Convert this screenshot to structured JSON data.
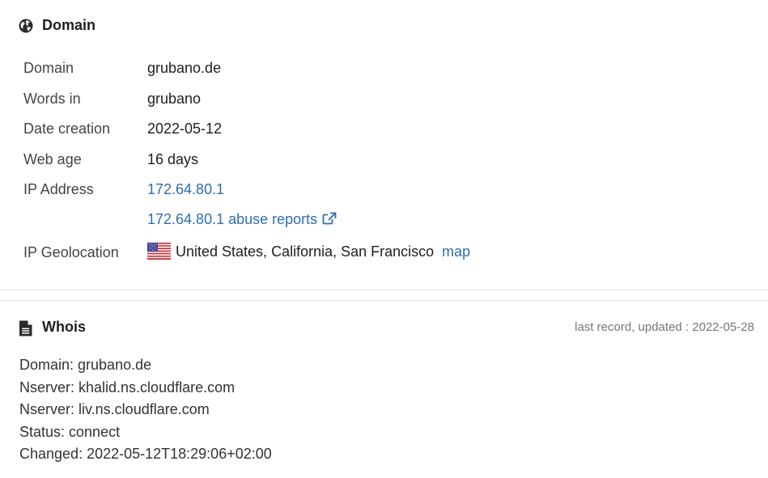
{
  "domain_section": {
    "title": "Domain",
    "icon": "globe-icon",
    "rows": {
      "domain": {
        "label": "Domain",
        "value": "grubano.de"
      },
      "words": {
        "label": "Words in",
        "value": "grubano"
      },
      "created": {
        "label": "Date creation",
        "value": "2022-05-12"
      },
      "age": {
        "label": "Web age",
        "value": "16 days"
      },
      "ip": {
        "label": "IP Address",
        "value": "172.64.80.1"
      },
      "abuse": {
        "value": "172.64.80.1 abuse reports"
      },
      "geo": {
        "label": "IP Geolocation",
        "value": "United States, California, San Francisco",
        "map_label": "map"
      }
    }
  },
  "whois_section": {
    "title": "Whois",
    "icon": "document-icon",
    "updated": "last record, updated : 2022-05-28",
    "lines": [
      "Domain: grubano.de",
      "Nserver: khalid.ns.cloudflare.com",
      "Nserver: liv.ns.cloudflare.com",
      "Status: connect",
      "Changed: 2022-05-12T18:29:06+02:00"
    ]
  },
  "colors": {
    "link": "#2f6eb0",
    "label": "#444444",
    "text": "#222222",
    "muted": "#777777"
  }
}
